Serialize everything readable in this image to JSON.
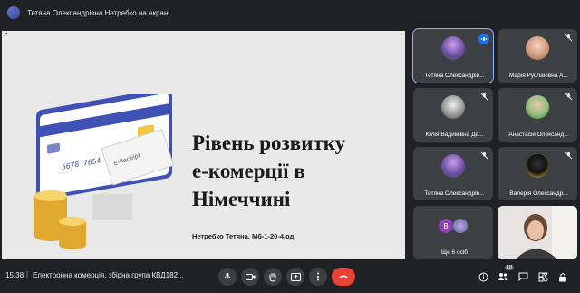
{
  "header": {
    "presenting_text": "Тетяна Олександрівна Нетребко на екрані"
  },
  "slide": {
    "title_lines": [
      "Рівень розвитку",
      "е-комерції в",
      "Німеччині"
    ],
    "author": "Нетребко Тетяна, Мб-1-20-4.од",
    "card_number": "5678  7654  3210",
    "receipt_text": "E-Receipt"
  },
  "participants": [
    {
      "name": "Тетяна Олександрів...",
      "state": "speaking"
    },
    {
      "name": "Марія Русланівна А...",
      "state": "muted"
    },
    {
      "name": "Юлія Вадимівна Де...",
      "state": "muted"
    },
    {
      "name": "Анастасія Олександ...",
      "state": "muted"
    },
    {
      "name": "Тетяна Олександрів...",
      "state": "muted"
    },
    {
      "name": "Валерія Олександр...",
      "state": "muted"
    }
  ],
  "more": {
    "label": "Ще 6 осіб",
    "initial": "В"
  },
  "bottom": {
    "time": "15:38",
    "separator": "|",
    "meeting_name": "Електронна комерція, збірна група КВД182...",
    "participant_count": "18"
  },
  "colors": {
    "accent": "#8ab4f8",
    "end_call": "#ea4335",
    "speaking": "#1a73e8",
    "card_blue": "#3f51b5"
  },
  "icons": [
    "microphone-icon",
    "camera-icon",
    "raise-hand-icon",
    "present-screen-icon",
    "more-options-icon",
    "end-call-icon",
    "info-icon",
    "people-icon",
    "chat-icon",
    "activities-icon",
    "lock-icon"
  ]
}
